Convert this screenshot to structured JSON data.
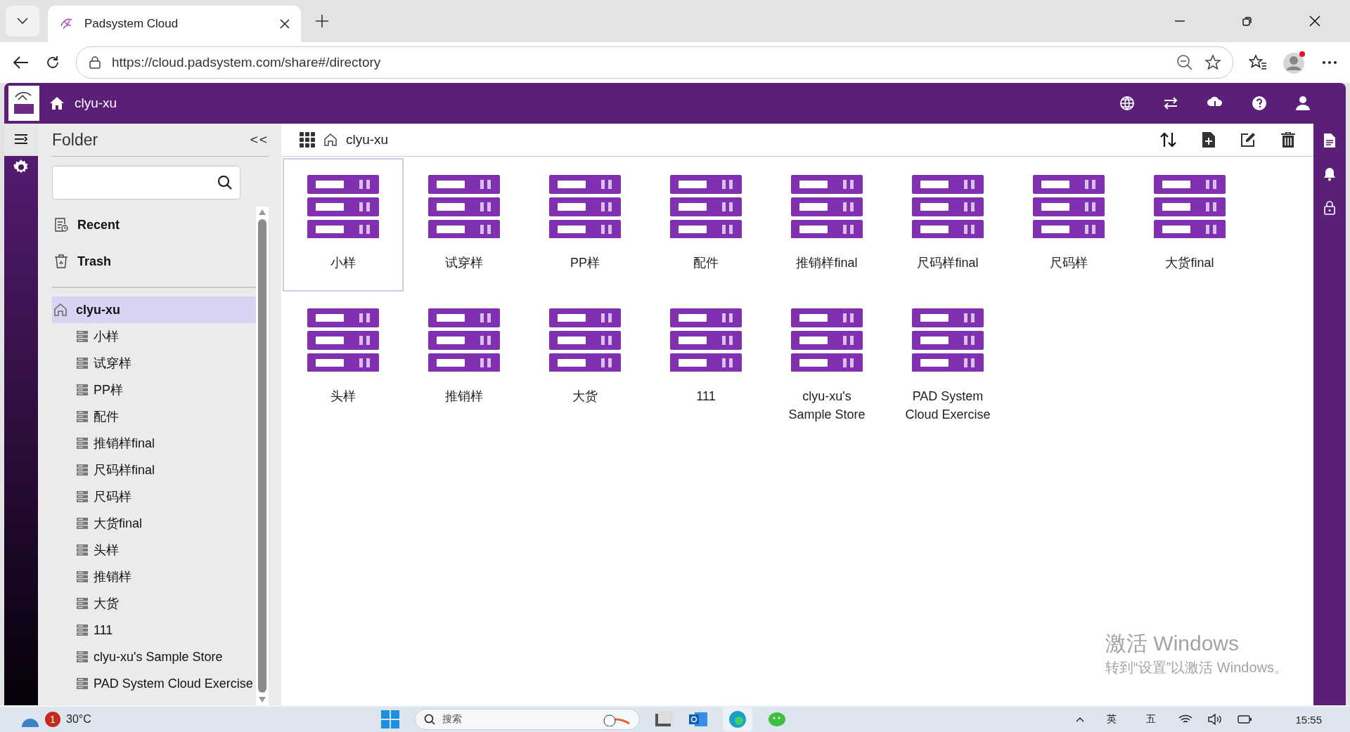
{
  "browser": {
    "tab_title": "Padsystem Cloud",
    "url": "https://cloud.padsystem.com/share#/directory"
  },
  "header": {
    "breadcrumb": "clyu-xu"
  },
  "sidebar": {
    "title": "Folder",
    "collapse": "<<",
    "nav": [
      {
        "label": "Recent",
        "kind": "recent"
      },
      {
        "label": "Trash",
        "kind": "trash"
      }
    ],
    "tree": {
      "label": "clyu-xu",
      "selected": true,
      "children": [
        {
          "label": "小样",
          "selected": false
        },
        {
          "label": "试穿样",
          "selected": false
        },
        {
          "label": "PP样",
          "selected": false
        },
        {
          "label": "配件",
          "selected": false
        },
        {
          "label": "推销样final",
          "selected": false
        },
        {
          "label": "尺码样final",
          "selected": false
        },
        {
          "label": "尺码样",
          "selected": false
        },
        {
          "label": "大货final",
          "selected": false
        },
        {
          "label": "头样",
          "selected": false
        },
        {
          "label": "推销样",
          "selected": false
        },
        {
          "label": "大货",
          "selected": false
        },
        {
          "label": "111",
          "selected": false
        },
        {
          "label": "clyu-xu's Sample Store",
          "selected": false
        },
        {
          "label": "PAD System Cloud Exercise",
          "selected": false
        }
      ]
    }
  },
  "main": {
    "breadcrumb": "clyu-xu",
    "items": [
      {
        "label": "小样",
        "selected": true
      },
      {
        "label": "试穿样",
        "selected": false
      },
      {
        "label": "PP样",
        "selected": false
      },
      {
        "label": "配件",
        "selected": false
      },
      {
        "label": "推销样final",
        "selected": false
      },
      {
        "label": "尺码样final",
        "selected": false
      },
      {
        "label": "尺码样",
        "selected": false
      },
      {
        "label": "大货final",
        "selected": false
      },
      {
        "label": "头样",
        "selected": false
      },
      {
        "label": "推销样",
        "selected": false
      },
      {
        "label": "大货",
        "selected": false
      },
      {
        "label": "111",
        "selected": false
      },
      {
        "label": "clyu-xu's Sample Store",
        "selected": false
      },
      {
        "label": "PAD System Cloud Exercise",
        "selected": false
      }
    ]
  },
  "activation": {
    "title": "激活 Windows",
    "subtitle": "转到“设置”以激活 Windows。"
  },
  "taskbar": {
    "badge": "1",
    "temperature": "30°C",
    "search_placeholder": "搜索",
    "ime": [
      "英",
      "五"
    ],
    "time": "15:55"
  }
}
